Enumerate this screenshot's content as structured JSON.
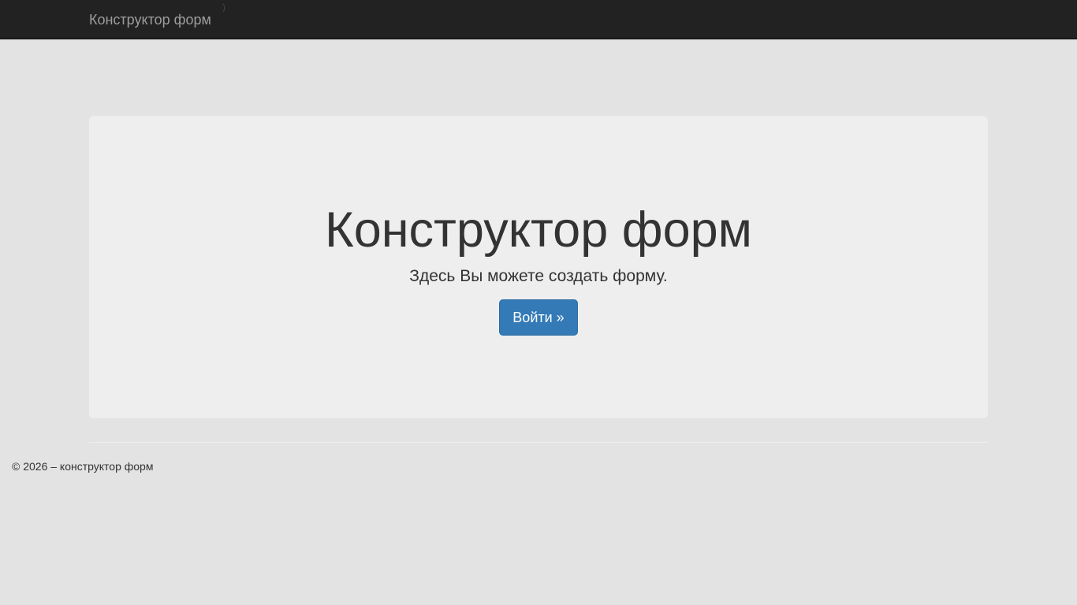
{
  "navbar": {
    "brand": "Конструктор форм",
    "mark": ")"
  },
  "jumbotron": {
    "title": "Конструктор форм",
    "lead": "Здесь Вы можете создать форму.",
    "login_button": "Войти »"
  },
  "footer": {
    "copyright": "© 2026 – конструктор форм"
  },
  "colors": {
    "navbar_bg": "#222222",
    "page_bg": "#e3e3e3",
    "jumbotron_bg": "#eeeeee",
    "primary": "#337ab7"
  }
}
